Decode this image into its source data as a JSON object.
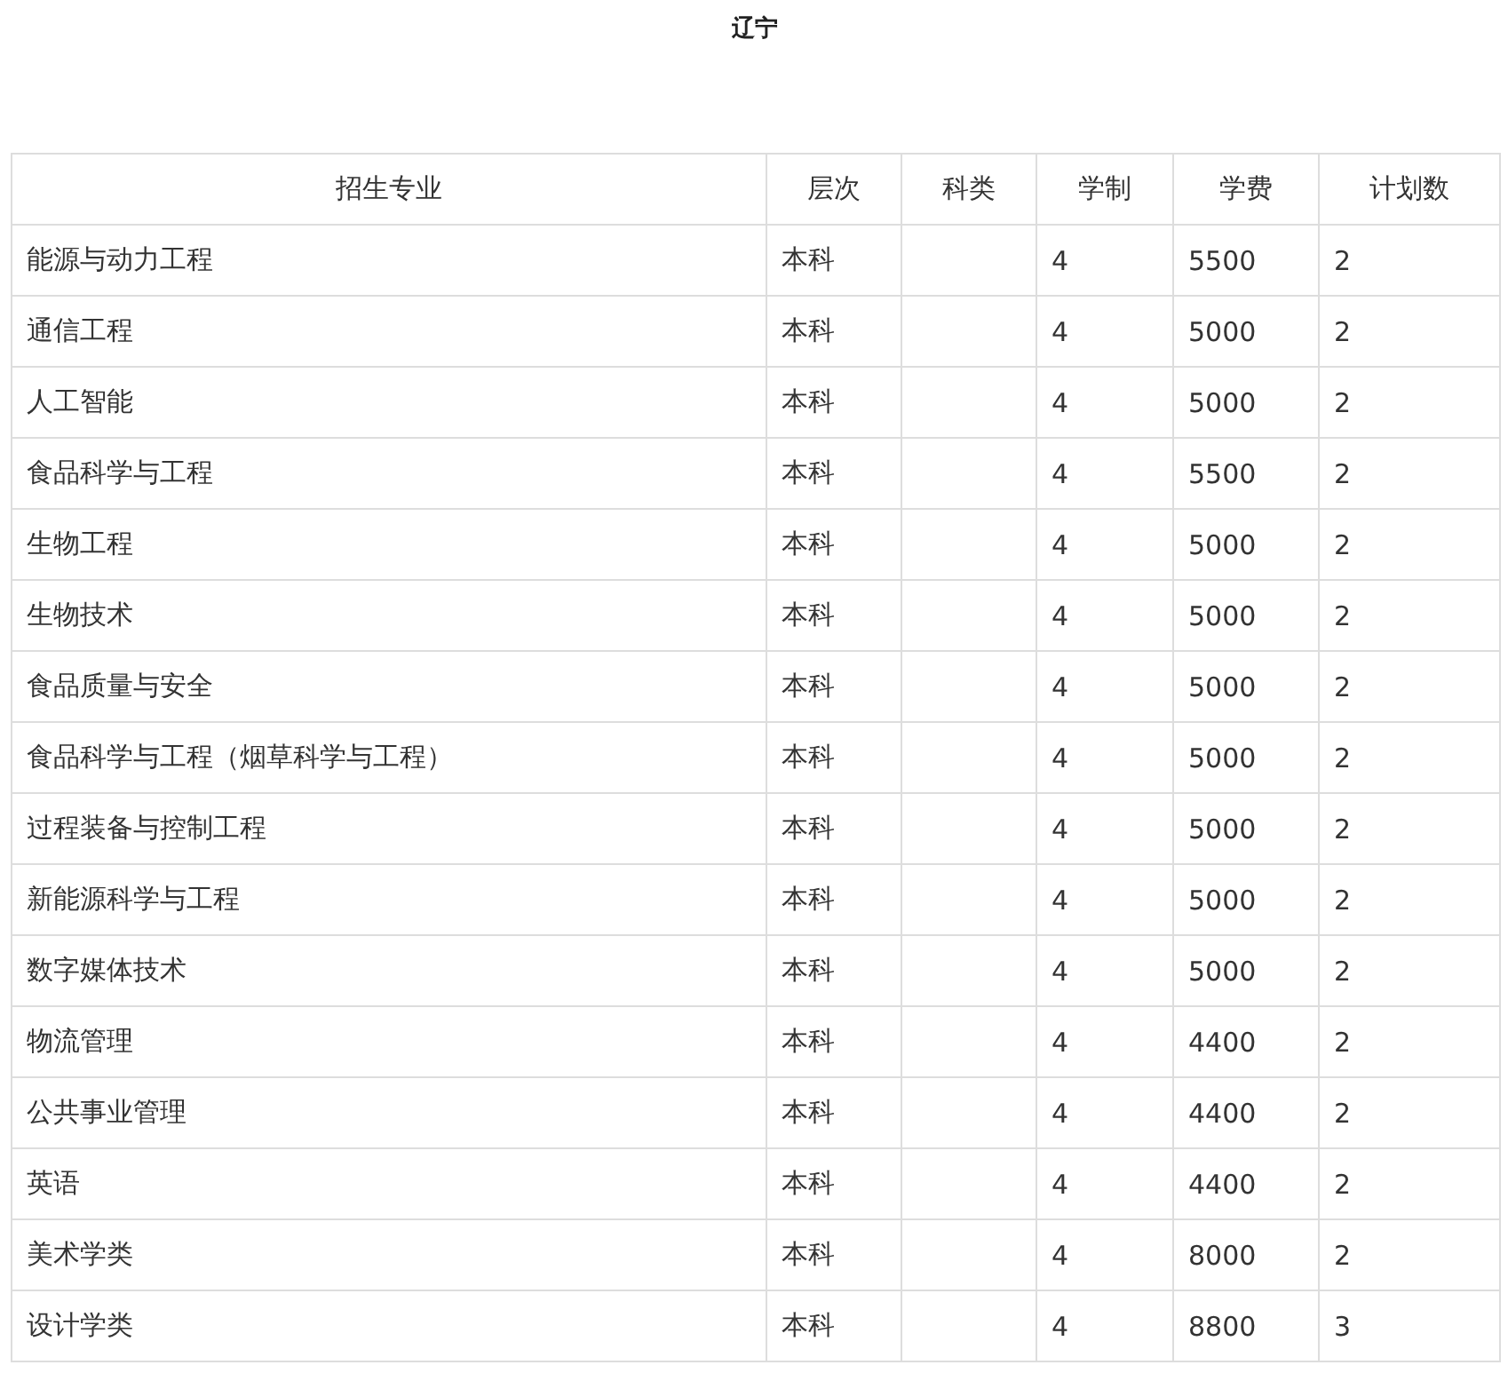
{
  "title": "辽宁",
  "table": {
    "columns": [
      "招生专业",
      "层次",
      "科类",
      "学制",
      "学费",
      "计划数"
    ],
    "rows": [
      {
        "major": "能源与动力工程",
        "level": "本科",
        "duration": "4",
        "fee": "5500",
        "quota": "2"
      },
      {
        "major": "通信工程",
        "level": "本科",
        "duration": "4",
        "fee": "5000",
        "quota": "2"
      },
      {
        "major": "人工智能",
        "level": "本科",
        "duration": "4",
        "fee": "5000",
        "quota": "2"
      },
      {
        "major": "食品科学与工程",
        "level": "本科",
        "duration": "4",
        "fee": "5500",
        "quota": "2"
      },
      {
        "major": "生物工程",
        "level": "本科",
        "duration": "4",
        "fee": "5000",
        "quota": "2"
      },
      {
        "major": "生物技术",
        "level": "本科",
        "duration": "4",
        "fee": "5000",
        "quota": "2"
      },
      {
        "major": "食品质量与安全",
        "level": "本科",
        "duration": "4",
        "fee": "5000",
        "quota": "2"
      },
      {
        "major": "食品科学与工程（烟草科学与工程）",
        "level": "本科",
        "duration": "4",
        "fee": "5000",
        "quota": "2"
      },
      {
        "major": "过程装备与控制工程",
        "level": "本科",
        "duration": "4",
        "fee": "5000",
        "quota": "2"
      },
      {
        "major": "新能源科学与工程",
        "level": "本科",
        "duration": "4",
        "fee": "5000",
        "quota": "2"
      },
      {
        "major": "数字媒体技术",
        "level": "本科",
        "duration": "4",
        "fee": "5000",
        "quota": "2"
      },
      {
        "major": "物流管理",
        "level": "本科",
        "duration": "4",
        "fee": "4400",
        "quota": "2"
      },
      {
        "major": "公共事业管理",
        "level": "本科",
        "duration": "4",
        "fee": "4400",
        "quota": "2"
      },
      {
        "major": "英语",
        "level": "本科",
        "duration": "4",
        "fee": "4400",
        "quota": "2"
      },
      {
        "major": "美术学类",
        "level": "本科",
        "duration": "4",
        "fee": "8000",
        "quota": "2"
      },
      {
        "major": "设计学类",
        "level": "本科",
        "duration": "4",
        "fee": "8800",
        "quota": "3"
      }
    ]
  }
}
